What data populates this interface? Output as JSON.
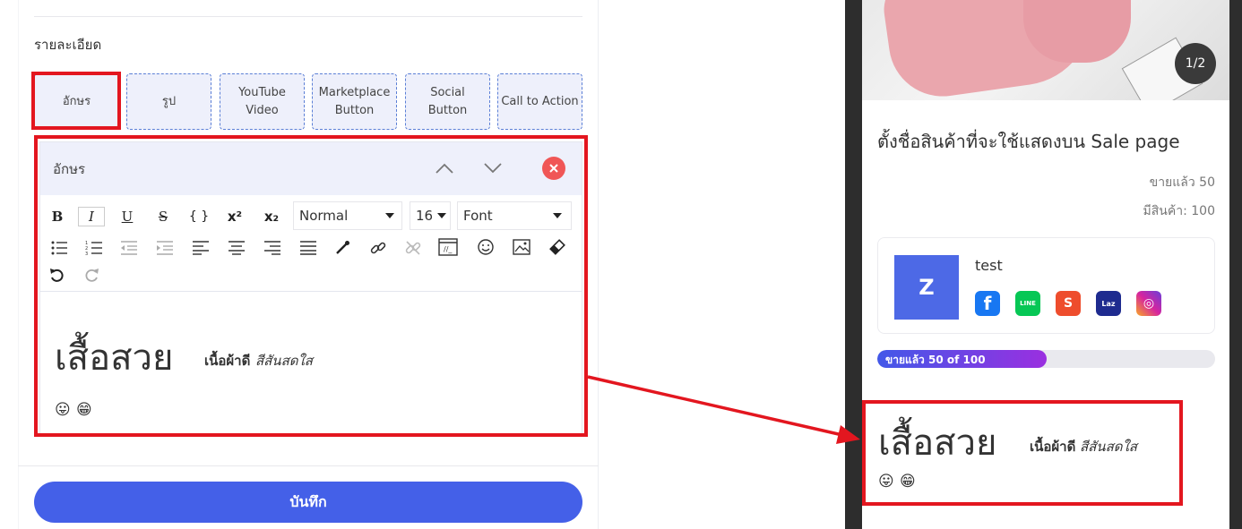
{
  "editor": {
    "section_title": "รายละเอียด",
    "block_types": [
      {
        "label": "อักษร"
      },
      {
        "label": "รูป"
      },
      {
        "label": "YouTube\nVideo"
      },
      {
        "label": "Marketplace\nButton"
      },
      {
        "label": "Social\nButton"
      },
      {
        "label": "Call to Action"
      }
    ],
    "text_block": {
      "title": "อักษร",
      "toolbar": {
        "bold": "B",
        "italic": "I",
        "underline": "U",
        "strike": "S",
        "code": "{ }",
        "superscript": "x²",
        "subscript": "x₂",
        "heading_select": "Normal",
        "size_select": "16",
        "font_select": "Font"
      },
      "content": {
        "heading": "เสื้อสวย",
        "bold_text": "เนื้อผ้าดี",
        "italic_text": "สีสันสดใส",
        "emoji_1": "😛",
        "emoji_2": "😁"
      }
    },
    "save_label": "บันทึก"
  },
  "preview": {
    "image_counter": "1/2",
    "product_title": "ตั้งชื่อสินค้าที่จะใช้แสดงบน Sale page",
    "sold_text": "ขายแล้ว 50",
    "stock_text": "มีสินค้า: 100",
    "shop": {
      "avatar_letter": "Z",
      "name": "test",
      "socials": [
        {
          "icon": "facebook-icon",
          "glyph": "f",
          "color": "#1877f2"
        },
        {
          "icon": "line-icon",
          "glyph": "LINE",
          "color": "#06c755"
        },
        {
          "icon": "shopee-icon",
          "glyph": "S",
          "color": "#ee4d2d"
        },
        {
          "icon": "lazada-icon",
          "glyph": "Laz",
          "color": "#1e2b8f"
        },
        {
          "icon": "instagram-icon",
          "glyph": "◎",
          "color": "#d6249f"
        }
      ]
    },
    "progress": {
      "label": "ขายแล้ว 50 of 100",
      "sold": 50,
      "total": 100
    },
    "text_block": {
      "heading": "เสื้อสวย",
      "bold_text": "เนื้อผ้าดี",
      "italic_text": "สีสันสดใส",
      "emoji_1": "😛",
      "emoji_2": "😁"
    }
  },
  "colors": {
    "accent": "#4460e8",
    "highlight": "#e3161f",
    "close": "#f05656",
    "progress_start": "#4258e8",
    "progress_end": "#9a2fe0"
  }
}
